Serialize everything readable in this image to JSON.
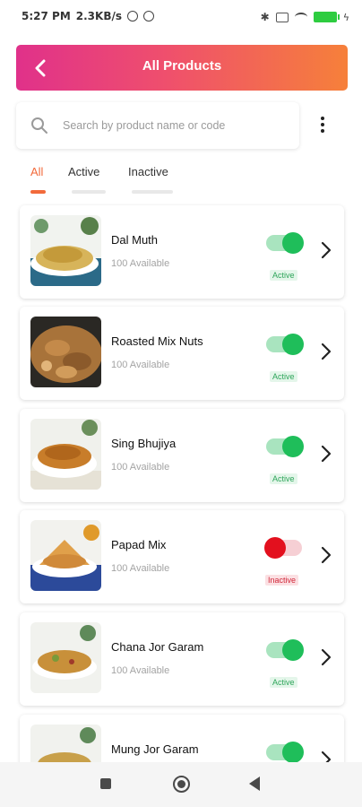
{
  "status_bar": {
    "time": "5:27 PM",
    "net_speed": "2.3KB/s"
  },
  "header": {
    "title": "All Products",
    "back_icon": "back-arrow-icon",
    "gradient": [
      "#e0318a",
      "#f6803a"
    ]
  },
  "search": {
    "placeholder": "Search by product name or code",
    "value": ""
  },
  "tabs": [
    {
      "label": "All",
      "active": true
    },
    {
      "label": "Active",
      "active": false
    },
    {
      "label": "Inactive",
      "active": false
    }
  ],
  "colors": {
    "accent": "#f26a3b",
    "active_green": "#1fbe5a",
    "inactive_red": "#e3101e"
  },
  "products": [
    {
      "name": "Dal Muth",
      "availability": "100 Available",
      "status": "Active",
      "enabled": true
    },
    {
      "name": "Roasted Mix Nuts",
      "availability": "100 Available",
      "status": "Active",
      "enabled": true
    },
    {
      "name": "Sing Bhujiya",
      "availability": "100 Available",
      "status": "Active",
      "enabled": true
    },
    {
      "name": "Papad Mix",
      "availability": "100 Available",
      "status": "Inactive",
      "enabled": false
    },
    {
      "name": "Chana Jor Garam",
      "availability": "100 Available",
      "status": "Active",
      "enabled": true
    },
    {
      "name": "Mung Jor Garam",
      "availability": "",
      "status": "",
      "enabled": true
    }
  ]
}
